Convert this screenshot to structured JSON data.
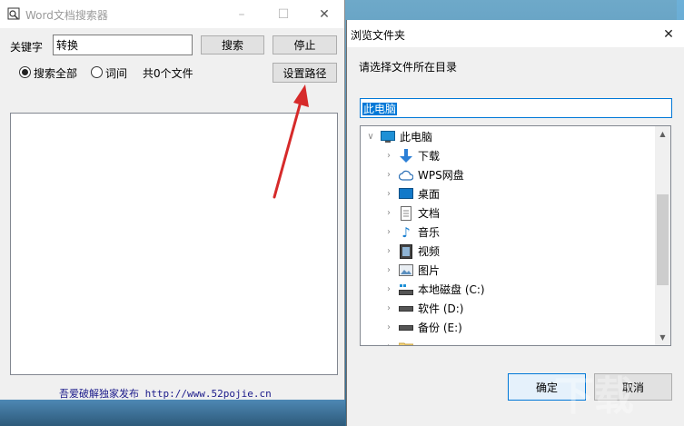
{
  "app": {
    "title": "Word文档搜索器",
    "keyword_label": "关键字",
    "keyword_value": "转换",
    "search_button": "搜索",
    "stop_button": "停止",
    "radio_all": "搜索全部",
    "radio_word": "词间",
    "file_count": "共0个文件",
    "set_path_button": "设置路径",
    "footer": "吾爱破解独家发布 http://www.52pojie.cn"
  },
  "dialog": {
    "title": "浏览文件夹",
    "description": "请选择文件所在目录",
    "selected_path": "此电脑",
    "tree": [
      {
        "label": "此电脑",
        "icon": "computer-icon",
        "level": 0,
        "expanded": true
      },
      {
        "label": "下载",
        "icon": "download-icon",
        "level": 1
      },
      {
        "label": "WPS网盘",
        "icon": "cloud-icon",
        "level": 1
      },
      {
        "label": "桌面",
        "icon": "desktop-icon",
        "level": 1
      },
      {
        "label": "文档",
        "icon": "document-icon",
        "level": 1
      },
      {
        "label": "音乐",
        "icon": "music-icon",
        "level": 1
      },
      {
        "label": "视频",
        "icon": "video-icon",
        "level": 1
      },
      {
        "label": "图片",
        "icon": "picture-icon",
        "level": 1
      },
      {
        "label": "本地磁盘 (C:)",
        "icon": "drive-icon",
        "level": 1
      },
      {
        "label": "软件 (D:)",
        "icon": "drive-icon",
        "level": 1
      },
      {
        "label": "备份 (E:)",
        "icon": "drive-icon",
        "level": 1
      }
    ],
    "ok_button": "确定",
    "cancel_button": "取消"
  },
  "colors": {
    "accent": "#0078d7",
    "annotation_arrow": "#d62a2a"
  }
}
